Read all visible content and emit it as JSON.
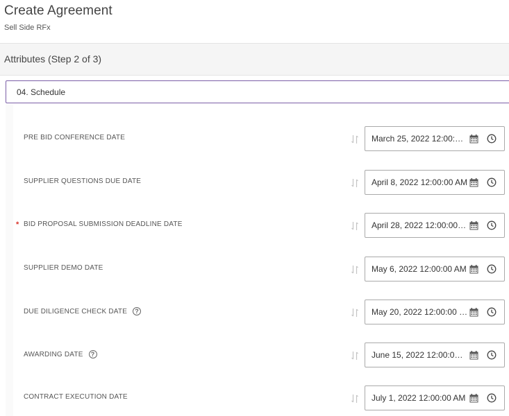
{
  "header": {
    "title": "Create Agreement",
    "subtitle": "Sell Side RFx"
  },
  "step": {
    "label": "Attributes (Step 2 of 3)"
  },
  "section": {
    "label": "04. Schedule"
  },
  "rows": [
    {
      "label": "PRE BID CONFERENCE DATE",
      "value": "March 25, 2022 12:00:…",
      "required": false,
      "help": false
    },
    {
      "label": "SUPPLIER QUESTIONS DUE DATE",
      "value": "April 8, 2022 12:00:00 AM",
      "required": false,
      "help": false
    },
    {
      "label": "BID PROPOSAL SUBMISSION DEADLINE DATE",
      "value": "April 28, 2022 12:00:00…",
      "required": true,
      "help": false
    },
    {
      "label": "SUPPLIER DEMO DATE",
      "value": "May 6, 2022 12:00:00 AM",
      "required": false,
      "help": false
    },
    {
      "label": "DUE DILIGENCE CHECK DATE",
      "value": "May 20, 2022 12:00:00 …",
      "required": false,
      "help": true
    },
    {
      "label": "AWARDING DATE",
      "value": "June 15, 2022 12:00:0…",
      "required": false,
      "help": true
    },
    {
      "label": "CONTRACT EXECUTION DATE",
      "value": "July 1, 2022 12:00:00 AM",
      "required": false,
      "help": false
    }
  ],
  "glyphs": {
    "required": "*",
    "help": "?"
  },
  "icons": {
    "calendar": "calendar-icon",
    "clock": "clock-icon",
    "sort": "sort-arrows-icon",
    "help": "help-circle-icon"
  },
  "colors": {
    "accent": "#7b5ea7",
    "required": "#d9342b"
  }
}
